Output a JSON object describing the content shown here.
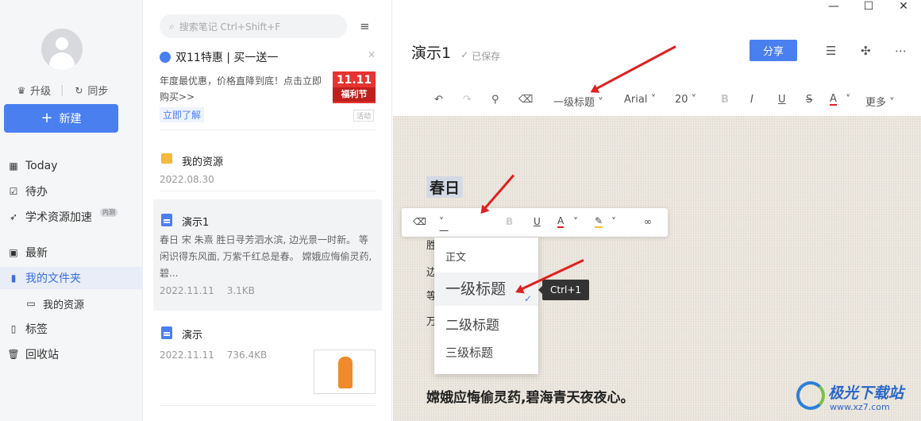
{
  "sidebar": {
    "upgrade": "升级",
    "sync": "同步",
    "new_button": "新建",
    "nav": [
      {
        "label": "Today",
        "icon": "calendar-icon"
      },
      {
        "label": "待办",
        "icon": "checkbox-icon"
      },
      {
        "label": "学术资源加速",
        "icon": "rocket-icon",
        "badge": "内测"
      },
      {
        "label": "最新",
        "icon": "grid-icon"
      },
      {
        "label": "我的文件夹",
        "icon": "folder-icon"
      },
      {
        "label": "我的资源",
        "icon": "folder-outline-icon"
      },
      {
        "label": "标签",
        "icon": "bookmark-icon"
      },
      {
        "label": "回收站",
        "icon": "trash-icon"
      }
    ]
  },
  "list": {
    "search_placeholder": "搜索笔记 Ctrl+Shift+F",
    "promo": {
      "title": "双11特惠 | 买一送一",
      "desc": "年度最优惠，价格直降到底！点击立即购买>>",
      "link": "立即了解",
      "tag": "活动",
      "img_line1": "11.11",
      "img_line2": "福利节"
    },
    "items": [
      {
        "title": "我的资源",
        "date": "2022.08.30"
      },
      {
        "title": "演示1",
        "snippet": "春日 宋 朱熹 胜日寻芳泗水滨, 边光景一时新。 等闲识得东风面, 万紫千红总是春。 嫦娥应悔偷灵药,碧...",
        "date": "2022.11.11",
        "size": "3.1KB"
      },
      {
        "title": "演示",
        "date": "2022.11.11",
        "size": "736.4KB"
      }
    ]
  },
  "editor": {
    "doc_title": "演示1",
    "saved": "已保存",
    "share": "分享",
    "toolbar": {
      "heading": "一级标题",
      "font": "Arial",
      "size": "20",
      "bold": "B",
      "italic": "I",
      "underline": "U",
      "strike": "S",
      "color": "A",
      "more": "更多"
    },
    "content": {
      "heading": "春日",
      "fragments": [
        "胜",
        "边",
        "等",
        "万"
      ],
      "last_line": "嫦娥应悔偷灵药,碧海青天夜夜心。"
    },
    "float_toolbar": {
      "heading": "一级标题",
      "bold": "B",
      "underline": "U",
      "color": "A"
    },
    "dropdown": [
      "正文",
      "一级标题",
      "二级标题",
      "三级标题"
    ],
    "tooltip": "Ctrl+1"
  },
  "watermark": {
    "name": "极光下载站",
    "url": "www.xz7.com"
  },
  "colors": {
    "accent": "#4a7ff0",
    "arrow": "#e02020"
  }
}
